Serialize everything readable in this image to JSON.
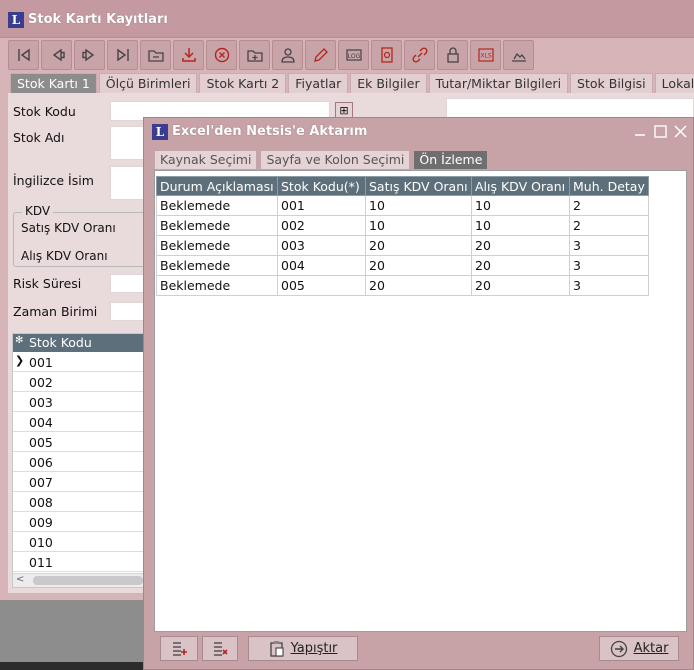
{
  "back_window": {
    "title": "Stok Kartı Kayıtları",
    "toolbar_icons": [
      "first-icon",
      "prev-icon",
      "next-icon",
      "last-icon",
      "folder-icon",
      "download-icon",
      "delete-icon",
      "add-folder-icon",
      "user-icon",
      "edit-icon",
      "log-icon",
      "report-icon",
      "link-icon",
      "lock-icon",
      "xls-icon",
      "image-icon"
    ],
    "tabs": [
      "Stok Kartı 1",
      "Ölçü Birimleri",
      "Stok Kartı 2",
      "Fiyatlar",
      "Ek Bilgiler",
      "Tutar/Miktar Bilgileri",
      "Stok Bilgisi",
      "Lokal D"
    ],
    "active_tab": "Stok Kartı 1",
    "fields": {
      "stok_kodu": "Stok Kodu",
      "stok_adi": "Stok Adı",
      "ingilizce_isim": "İngilizce İsim",
      "kdv_group": "KDV",
      "satis_kdv": "Satış KDV Oranı",
      "alis_kdv": "Alış KDV Oranı",
      "risk_suresi": "Risk Süresi",
      "zaman_birimi": "Zaman Birimi"
    },
    "list": {
      "header": "Stok Kodu",
      "star": "✻",
      "items": [
        "001",
        "002",
        "003",
        "004",
        "005",
        "006",
        "007",
        "008",
        "009",
        "010",
        "011"
      ]
    }
  },
  "dialog": {
    "title": "Excel'den Netsis'e Aktarım",
    "tabs": [
      "Kaynak Seçimi",
      "Sayfa ve Kolon Seçimi",
      "Ön İzleme"
    ],
    "active_tab": "Ön İzleme",
    "table": {
      "columns": [
        "Durum Açıklaması",
        "Stok Kodu(*)",
        "Satış KDV Oranı",
        "Alış KDV Oranı",
        "Muh. Detay"
      ],
      "rows": [
        [
          "Beklemede",
          "001",
          "10",
          "10",
          "2"
        ],
        [
          "Beklemede",
          "002",
          "10",
          "10",
          "2"
        ],
        [
          "Beklemede",
          "003",
          "20",
          "20",
          "3"
        ],
        [
          "Beklemede",
          "004",
          "20",
          "20",
          "3"
        ],
        [
          "Beklemede",
          "005",
          "20",
          "20",
          "3"
        ]
      ]
    },
    "buttons": {
      "paste": "Yapıştır",
      "transfer": "Aktar"
    }
  },
  "colors": {
    "title_bar": "#c49aa0",
    "grid_header": "#5c6f7a",
    "active_tab": "#6f6f6f",
    "logo": "#3b3e8f"
  }
}
